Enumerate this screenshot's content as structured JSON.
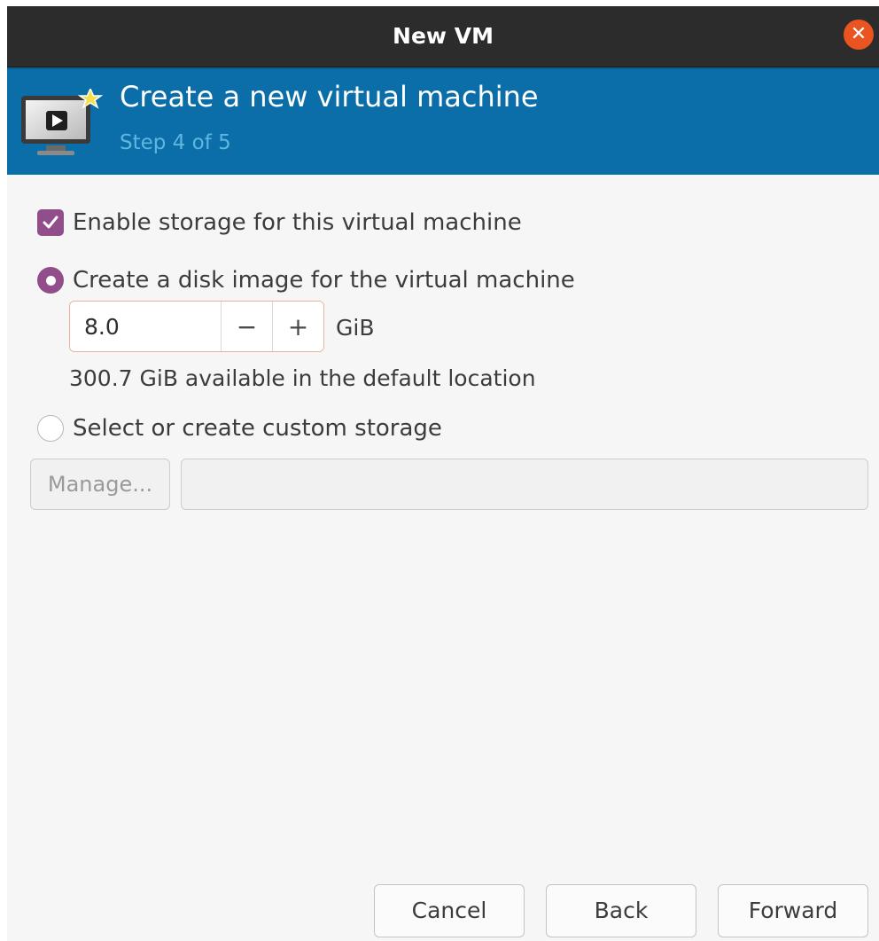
{
  "window": {
    "title": "New VM"
  },
  "icons": {
    "close": "close-icon",
    "vm": "monitor-play-icon",
    "check": "checkmark-icon"
  },
  "colors": {
    "accent": "#924d8b",
    "banner": "#0b6ea8",
    "titlebar": "#2c2c2c",
    "close": "#e95420"
  },
  "banner": {
    "title": "Create a new virtual machine",
    "step": "Step 4 of 5"
  },
  "storage": {
    "enable_label": "Enable storage for this virtual machine",
    "enable_checked": true,
    "create_disk_label": "Create a disk image for the virtual machine",
    "create_disk_selected": true,
    "size_value": "8.0",
    "decrement_label": "−",
    "increment_label": "+",
    "size_unit": "GiB",
    "available_text": "300.7 GiB available in the default location",
    "custom_label": "Select or create custom storage",
    "custom_selected": false,
    "manage_label": "Manage...",
    "custom_path_value": ""
  },
  "footer": {
    "cancel_label": "Cancel",
    "back_label": "Back",
    "forward_label": "Forward"
  }
}
